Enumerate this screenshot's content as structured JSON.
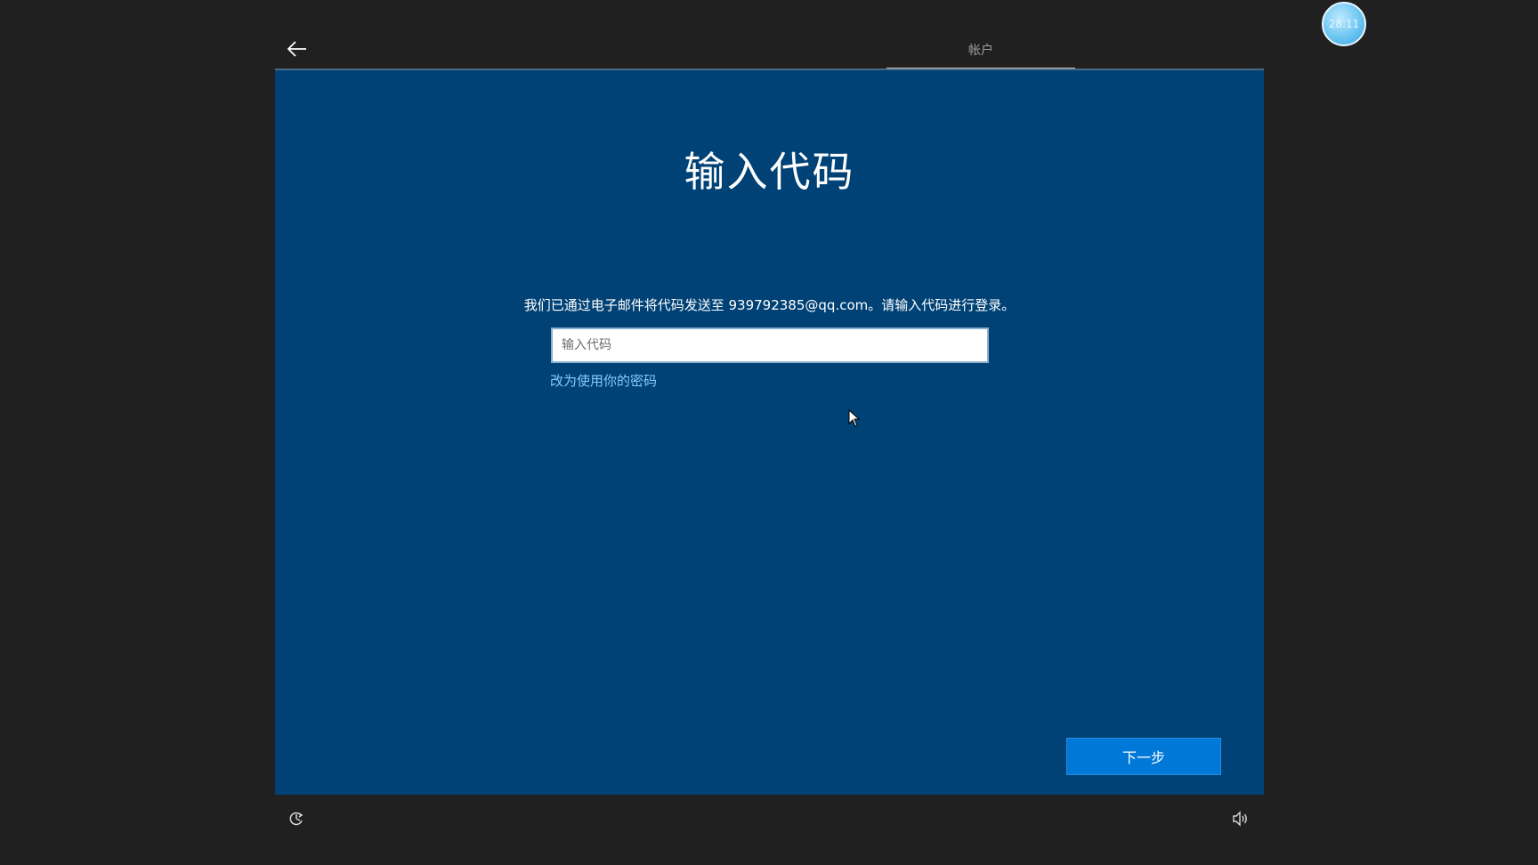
{
  "header": {
    "step_label": "帐户",
    "timer": "28:11"
  },
  "main": {
    "title": "输入代码",
    "instruction": "我们已通过电子邮件将代码发送至 939792385@qq.com。请输入代码进行登录。",
    "code_input": {
      "placeholder": "输入代码",
      "value": ""
    },
    "alt_link": "改为使用你的密码",
    "next_button": "下一步"
  },
  "colors": {
    "panel_bg": "#004275",
    "primary_button": "#0078d7",
    "link": "#88c9ff",
    "outer_bg": "#202020"
  },
  "icons": [
    "back-arrow-icon",
    "accessibility-icon",
    "volume-icon",
    "mouse-cursor-icon"
  ]
}
